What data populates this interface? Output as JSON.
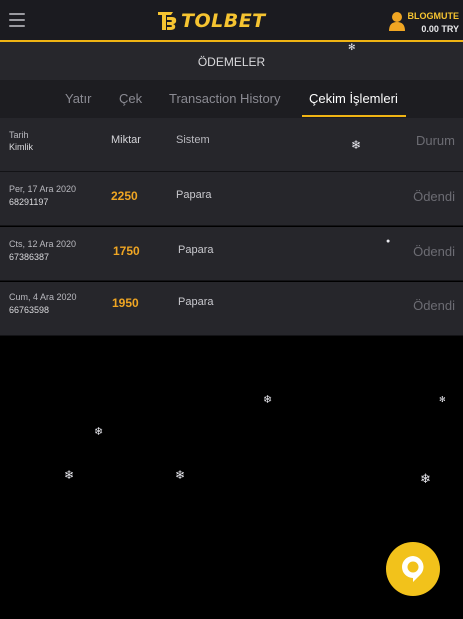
{
  "header": {
    "logo_text": "TOLBET",
    "username": "BLOGMUTE",
    "balance": "0.00 TRY",
    "brand_color": "#f6c431"
  },
  "page": {
    "title": "ÖDEMELER"
  },
  "tabs": [
    {
      "label": "Yatır"
    },
    {
      "label": "Çek"
    },
    {
      "label": "Transaction History"
    },
    {
      "label": "Çekim İşlemleri",
      "active": true
    }
  ],
  "table": {
    "headers": {
      "date": "Tarih",
      "id": "Kimlik",
      "amount": "Miktar",
      "system": "Sistem",
      "status": "Durum"
    },
    "rows": [
      {
        "date": "Per, 17 Ara 2020",
        "id": "68291197",
        "amount": "2250",
        "system": "Papara",
        "status": "Ödendi"
      },
      {
        "date": "Cts, 12 Ara 2020",
        "id": "67386387",
        "amount": "1750",
        "system": "Papara",
        "status": "Ödendi"
      },
      {
        "date": "Cum, 4 Ara 2020",
        "id": "66763598",
        "amount": "1950",
        "system": "Papara",
        "status": "Ödendi"
      }
    ]
  },
  "icons": {
    "menu": "hamburger-icon",
    "user": "user-icon",
    "chat": "chat-bubble-icon",
    "snow": "snowflake-icon"
  },
  "colors": {
    "accent": "#f0b414",
    "amount": "#f0a623",
    "chat_button": "#f2c21b"
  }
}
